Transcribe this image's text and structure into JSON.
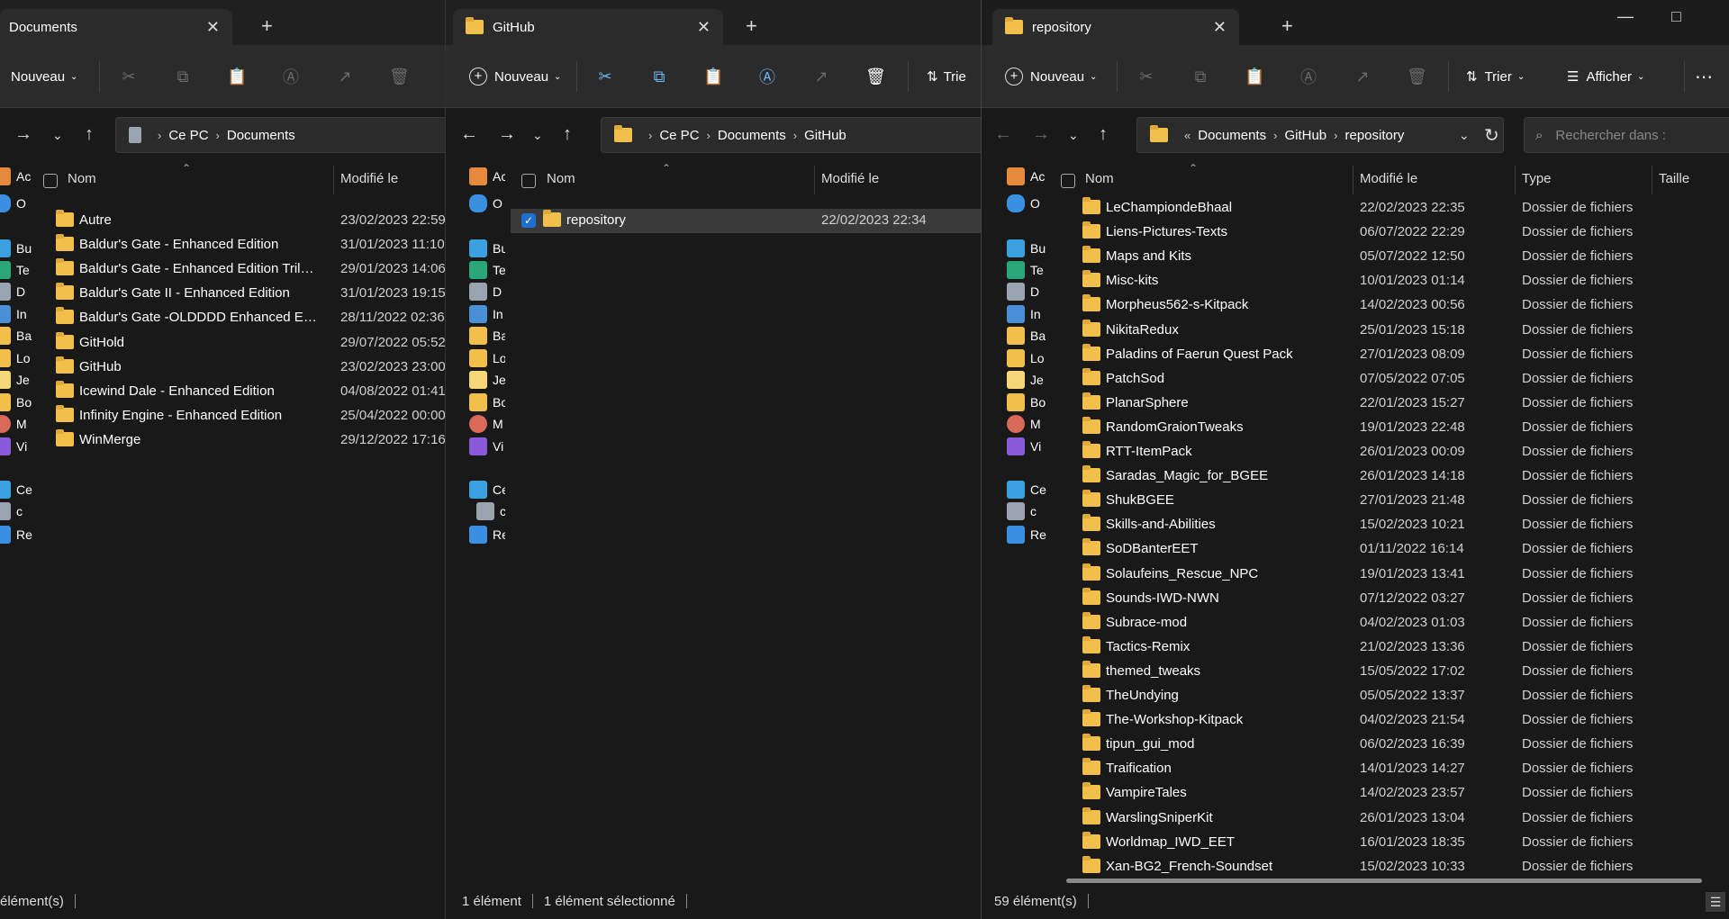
{
  "windows": [
    {
      "tab_title": "Documents",
      "toolbar": {
        "new_label": "Nouveau"
      },
      "address": [
        "Ce PC",
        "Documents"
      ],
      "columns": {
        "name": "Nom",
        "modified": "Modifié le"
      },
      "rows": [
        {
          "name": "Autre",
          "modified": "23/02/2023 22:59"
        },
        {
          "name": "Baldur's Gate - Enhanced Edition",
          "modified": "31/01/2023 11:10"
        },
        {
          "name": "Baldur's Gate - Enhanced Edition Trilo...",
          "modified": "29/01/2023 14:06"
        },
        {
          "name": "Baldur's Gate II - Enhanced Edition",
          "modified": "31/01/2023 19:15"
        },
        {
          "name": "Baldur's Gate -OLDDDD Enhanced Edi...",
          "modified": "28/11/2022 02:36"
        },
        {
          "name": "GitHold",
          "modified": "29/07/2022 05:52"
        },
        {
          "name": "GitHub",
          "modified": "23/02/2023 23:00"
        },
        {
          "name": "Icewind Dale - Enhanced Edition",
          "modified": "04/08/2022 01:41"
        },
        {
          "name": "Infinity Engine - Enhanced Edition",
          "modified": "25/04/2022 00:00"
        },
        {
          "name": "WinMerge",
          "modified": "29/12/2022 17:16"
        }
      ],
      "sidebar": [
        "Ac",
        "O",
        "Bu",
        "Te",
        "D",
        "In",
        "Ba",
        "Lo",
        "Je",
        "Bo",
        "M",
        "Vi",
        "Ce",
        "c",
        "Re"
      ],
      "status": "élément(s)"
    },
    {
      "tab_title": "GitHub",
      "toolbar": {
        "new_label": "Nouveau",
        "sort_label": "Trie"
      },
      "address": [
        "Ce PC",
        "Documents",
        "GitHub"
      ],
      "columns": {
        "name": "Nom",
        "modified": "Modifié le"
      },
      "rows": [
        {
          "name": "repository",
          "modified": "22/02/2023 22:34"
        }
      ],
      "sidebar": [
        "Ac",
        "O",
        "Bu",
        "Te",
        "D",
        "In",
        "Ba",
        "Lo",
        "Je",
        "Bo",
        "M",
        "Vi",
        "Ce",
        "c",
        "Re"
      ],
      "status": "1 élément",
      "status_selected": "1 élément sélectionné"
    },
    {
      "tab_title": "repository",
      "toolbar": {
        "new_label": "Nouveau",
        "sort_label": "Trier",
        "view_label": "Afficher"
      },
      "address": [
        "Documents",
        "GitHub",
        "repository"
      ],
      "search_placeholder": "Rechercher dans :",
      "columns": {
        "name": "Nom",
        "modified": "Modifié le",
        "type": "Type",
        "size": "Taille"
      },
      "rows": [
        {
          "name": "LeChampiondeBhaal",
          "modified": "22/02/2023 22:35",
          "type": "Dossier de fichiers"
        },
        {
          "name": "Liens-Pictures-Texts",
          "modified": "06/07/2022 22:29",
          "type": "Dossier de fichiers"
        },
        {
          "name": "Maps and Kits",
          "modified": "05/07/2022 12:50",
          "type": "Dossier de fichiers"
        },
        {
          "name": "Misc-kits",
          "modified": "10/01/2023 01:14",
          "type": "Dossier de fichiers"
        },
        {
          "name": "Morpheus562-s-Kitpack",
          "modified": "14/02/2023 00:56",
          "type": "Dossier de fichiers"
        },
        {
          "name": "NikitaRedux",
          "modified": "25/01/2023 15:18",
          "type": "Dossier de fichiers"
        },
        {
          "name": "Paladins of Faerun Quest Pack",
          "modified": "27/01/2023 08:09",
          "type": "Dossier de fichiers"
        },
        {
          "name": "PatchSod",
          "modified": "07/05/2022 07:05",
          "type": "Dossier de fichiers"
        },
        {
          "name": "PlanarSphere",
          "modified": "22/01/2023 15:27",
          "type": "Dossier de fichiers"
        },
        {
          "name": "RandomGraionTweaks",
          "modified": "19/01/2023 22:48",
          "type": "Dossier de fichiers"
        },
        {
          "name": "RTT-ItemPack",
          "modified": "26/01/2023 00:09",
          "type": "Dossier de fichiers"
        },
        {
          "name": "Saradas_Magic_for_BGEE",
          "modified": "26/01/2023 14:18",
          "type": "Dossier de fichiers"
        },
        {
          "name": "ShukBGEE",
          "modified": "27/01/2023 21:48",
          "type": "Dossier de fichiers"
        },
        {
          "name": "Skills-and-Abilities",
          "modified": "15/02/2023 10:21",
          "type": "Dossier de fichiers"
        },
        {
          "name": "SoDBanterEET",
          "modified": "01/11/2022 16:14",
          "type": "Dossier de fichiers"
        },
        {
          "name": "Solaufeins_Rescue_NPC",
          "modified": "19/01/2023 13:41",
          "type": "Dossier de fichiers"
        },
        {
          "name": "Sounds-IWD-NWN",
          "modified": "07/12/2022 03:27",
          "type": "Dossier de fichiers"
        },
        {
          "name": "Subrace-mod",
          "modified": "04/02/2023 01:03",
          "type": "Dossier de fichiers"
        },
        {
          "name": "Tactics-Remix",
          "modified": "21/02/2023 13:36",
          "type": "Dossier de fichiers"
        },
        {
          "name": "themed_tweaks",
          "modified": "15/05/2022 17:02",
          "type": "Dossier de fichiers"
        },
        {
          "name": "TheUndying",
          "modified": "05/05/2022 13:37",
          "type": "Dossier de fichiers"
        },
        {
          "name": "The-Workshop-Kitpack",
          "modified": "04/02/2023 21:54",
          "type": "Dossier de fichiers"
        },
        {
          "name": "tipun_gui_mod",
          "modified": "06/02/2023 16:39",
          "type": "Dossier de fichiers"
        },
        {
          "name": "Traification",
          "modified": "14/01/2023 14:27",
          "type": "Dossier de fichiers"
        },
        {
          "name": "VampireTales",
          "modified": "14/02/2023 23:57",
          "type": "Dossier de fichiers"
        },
        {
          "name": "WarslingSniperKit",
          "modified": "26/01/2023 13:04",
          "type": "Dossier de fichiers"
        },
        {
          "name": "Worldmap_IWD_EET",
          "modified": "16/01/2023 18:35",
          "type": "Dossier de fichiers"
        },
        {
          "name": "Xan-BG2_French-Soundset",
          "modified": "15/02/2023 10:33",
          "type": "Dossier de fichiers"
        }
      ],
      "sidebar": [
        "Ac",
        "O",
        "Bu",
        "Te",
        "D",
        "In",
        "Ba",
        "Lo",
        "Je",
        "Bo",
        "M",
        "Vi",
        "Ce",
        "c",
        "Re"
      ],
      "status": "59 élément(s)"
    }
  ],
  "colors": {
    "folder": "#f2c04a",
    "bg": "#191919",
    "toolbar": "#2b2b2b",
    "accent": "#1f6fd1"
  },
  "icons": [
    "folder-icon",
    "cut-icon",
    "copy-icon",
    "paste-icon",
    "rename-icon",
    "share-icon",
    "delete-icon",
    "sort-icon",
    "view-icon",
    "more-icon",
    "back-icon",
    "forward-icon",
    "up-icon",
    "refresh-icon",
    "search-icon",
    "minimize-icon",
    "maximize-icon",
    "close-icon"
  ]
}
